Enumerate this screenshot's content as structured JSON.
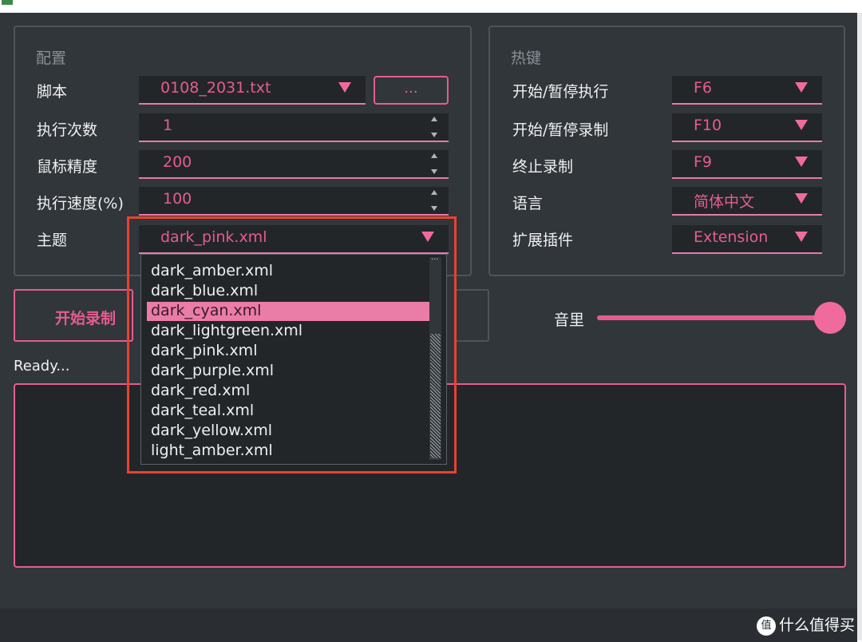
{
  "config": {
    "title": "配置",
    "rows": [
      {
        "label": "脚本",
        "value": "0108_2031.txt"
      },
      {
        "label": "执行次数",
        "value": "1"
      },
      {
        "label": "鼠标精度",
        "value": "200"
      },
      {
        "label": "执行速度(%)",
        "value": "100"
      },
      {
        "label": "主题",
        "value": "dark_pink.xml"
      }
    ],
    "browse_label": "..."
  },
  "hotkeys": {
    "title": "热键",
    "rows": [
      {
        "label": "开始/暂停执行",
        "value": "F6"
      },
      {
        "label": "开始/暂停录制",
        "value": "F10"
      },
      {
        "label": "终止录制",
        "value": "F9"
      },
      {
        "label": "语言",
        "value": "简体中文"
      },
      {
        "label": "扩展插件",
        "value": "Extension"
      }
    ]
  },
  "buttons": {
    "start_record": "开始录制"
  },
  "volume": {
    "label": "音里",
    "level_percent": 100
  },
  "status": "Ready...",
  "theme_dropdown": {
    "selected": "dark_cyan.xml",
    "options": [
      "dark_amber.xml",
      "dark_blue.xml",
      "dark_cyan.xml",
      "dark_lightgreen.xml",
      "dark_pink.xml",
      "dark_purple.xml",
      "dark_red.xml",
      "dark_teal.xml",
      "dark_yellow.xml",
      "light_amber.xml"
    ]
  },
  "watermark": {
    "text": "什么值得买",
    "icon_glyph": "值"
  },
  "colors": {
    "accent": "#e55c92",
    "background": "#31363b",
    "field": "#232629",
    "highlight": "#ea7ca8",
    "annotation": "#e8422f"
  }
}
